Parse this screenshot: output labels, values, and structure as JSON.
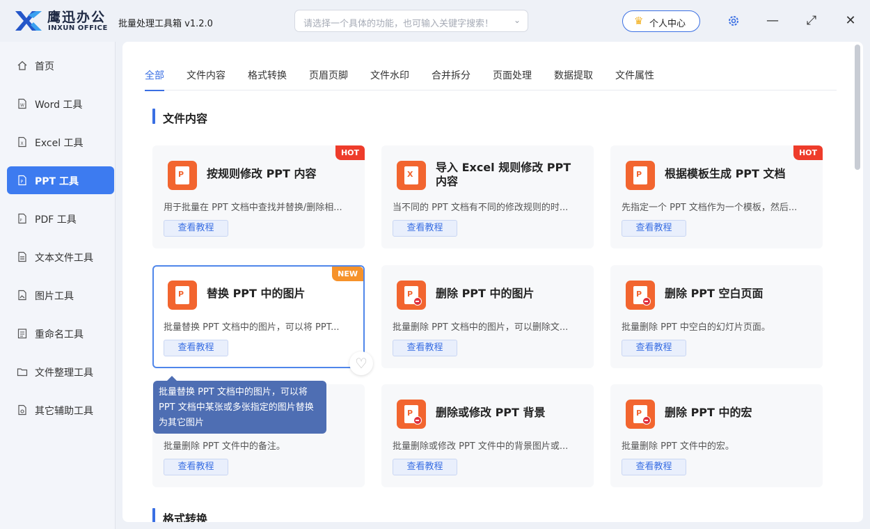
{
  "app": {
    "brand_cn": "鹰迅办公",
    "brand_en": "INXUN OFFICE",
    "title": "批量处理工具箱 v1.2.0",
    "search_placeholder": "请选择一个具体的功能，也可输入关键字搜索！",
    "personal_center": "个人中心"
  },
  "sidebar": {
    "items": [
      {
        "label": "首页",
        "icon": "home-icon"
      },
      {
        "label": "Word 工具",
        "icon": "word-file-icon"
      },
      {
        "label": "Excel 工具",
        "icon": "excel-file-icon"
      },
      {
        "label": "PPT 工具",
        "icon": "ppt-file-icon",
        "active": true
      },
      {
        "label": "PDF 工具",
        "icon": "pdf-file-icon"
      },
      {
        "label": "文本文件工具",
        "icon": "text-file-icon"
      },
      {
        "label": "图片工具",
        "icon": "image-file-icon"
      },
      {
        "label": "重命名工具",
        "icon": "rename-icon"
      },
      {
        "label": "文件整理工具",
        "icon": "folder-icon"
      },
      {
        "label": "其它辅助工具",
        "icon": "tools-icon"
      }
    ]
  },
  "tabs": [
    "全部",
    "文件内容",
    "格式转换",
    "页眉页脚",
    "文件水印",
    "合并拆分",
    "页面处理",
    "数据提取",
    "文件属性"
  ],
  "sections": {
    "content": "文件内容",
    "format": "格式转换"
  },
  "cards": [
    {
      "title": "按规则修改 PPT 内容",
      "desc": "用于批量在 PPT 文档中查找并替换/删除相...",
      "button": "查看教程",
      "badge": "HOT"
    },
    {
      "title": "导入 Excel 规则修改 PPT 内容",
      "desc": "当不同的 PPT 文档有不同的修改规则的时...",
      "button": "查看教程"
    },
    {
      "title": "根据模板生成 PPT 文档",
      "desc": "先指定一个 PPT 文档作为一个模板，然后...",
      "button": "查看教程",
      "badge": "HOT"
    },
    {
      "title": "替换 PPT 中的图片",
      "desc": "批量替换 PPT 文档中的图片，可以将 PPT...",
      "button": "查看教程",
      "badge": "NEW"
    },
    {
      "title": "删除 PPT 中的图片",
      "desc": "批量删除 PPT 文档中的图片，可以删除文...",
      "button": "查看教程"
    },
    {
      "title": "删除 PPT 空白页面",
      "desc": "批量删除 PPT 中空白的幻灯片页面。",
      "button": "查看教程"
    },
    {
      "title": "",
      "desc": "批量删除 PPT 文件中的备注。",
      "button": "查看教程"
    },
    {
      "title": "删除或修改 PPT 背景",
      "desc": "批量删除或修改 PPT 文件中的背景图片或...",
      "button": "查看教程"
    },
    {
      "title": "删除 PPT 中的宏",
      "desc": "批量删除 PPT 文件中的宏。",
      "button": "查看教程"
    }
  ],
  "tooltip": "批量替换 PPT 文档中的图片，可以将 PPT 文档中某张或多张指定的图片替换为其它图片",
  "colors": {
    "accent": "#3a6fe3",
    "ppt": "#f2652f",
    "hot": "#ee3c2b",
    "new": "#f6922a"
  }
}
